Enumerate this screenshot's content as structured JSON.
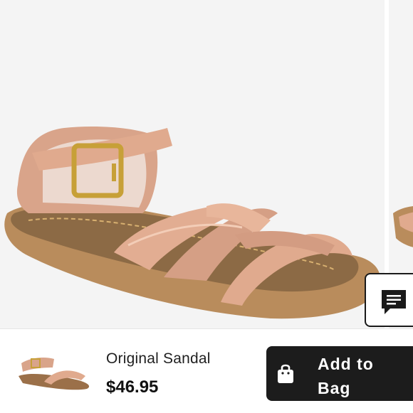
{
  "product": {
    "name": "Original Sandal",
    "price": "$46.95"
  },
  "actions": {
    "add_to_bag_label": "Add to Bag"
  },
  "icons": {
    "chat": "chat-bubble-icon",
    "bag": "shopping-bag-icon"
  },
  "colors": {
    "button_dark": "#1c1c1c",
    "photo_background": "#f4f4f4",
    "rose_gold": "#d9a78c"
  }
}
